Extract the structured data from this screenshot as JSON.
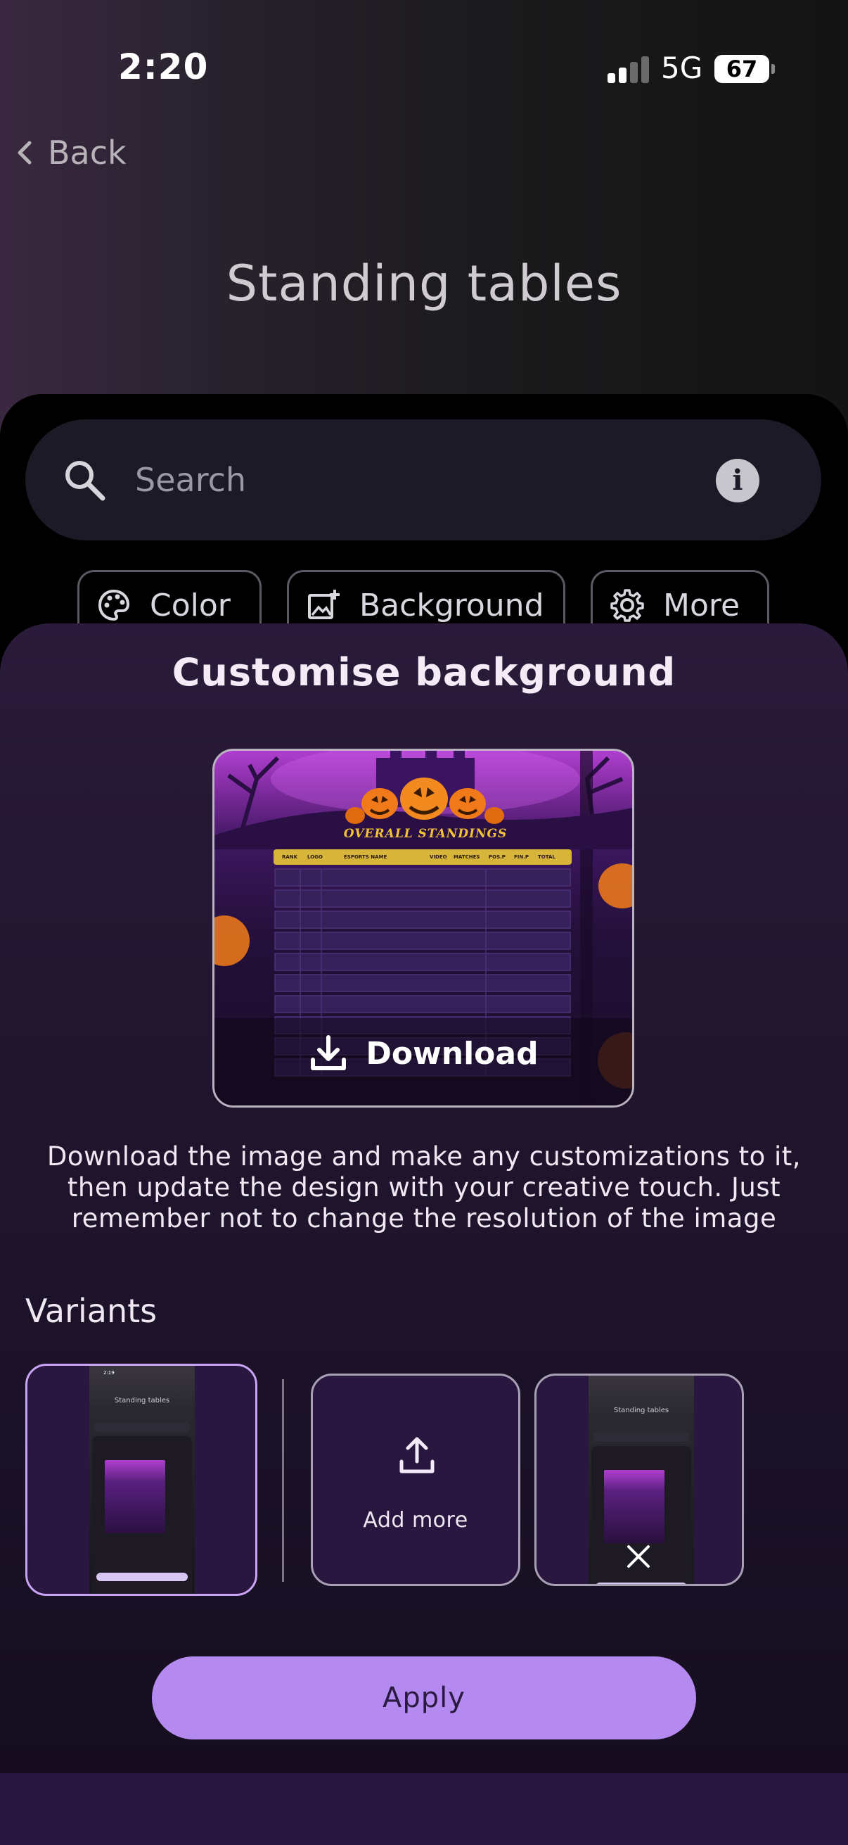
{
  "status": {
    "time": "2:20",
    "network": "5G",
    "battery": "67"
  },
  "header": {
    "back_label": "Back",
    "title": "Standing tables"
  },
  "search": {
    "placeholder": "Search"
  },
  "chips": [
    {
      "label": "Color",
      "icon": "palette-icon"
    },
    {
      "label": "Background",
      "icon": "add-photo-icon"
    },
    {
      "label": "More",
      "icon": "gear-icon"
    }
  ],
  "customise": {
    "title": "Customise background",
    "preview": {
      "heading": "OVERALL STANDINGS",
      "columns": [
        "RANK",
        "LOGO",
        "ESPORTS NAME",
        "VIDEO",
        "MATCHES",
        "POS.P",
        "FIN.P",
        "TOTAL"
      ]
    },
    "download_label": "Download",
    "description_lines": [
      "Download the image and make any customizations to it,",
      "then update the design with your creative touch. Just",
      "remember not to change the resolution of the image"
    ],
    "variants_label": "Variants",
    "add_more_label": "Add more",
    "variant_thumbnail": {
      "title": "Standing tables",
      "time": "2:19"
    },
    "apply_label": "Apply"
  },
  "colors": {
    "accent": "#b48af0",
    "sheet": "#22162f",
    "selected_border": "#c9a4f5"
  }
}
